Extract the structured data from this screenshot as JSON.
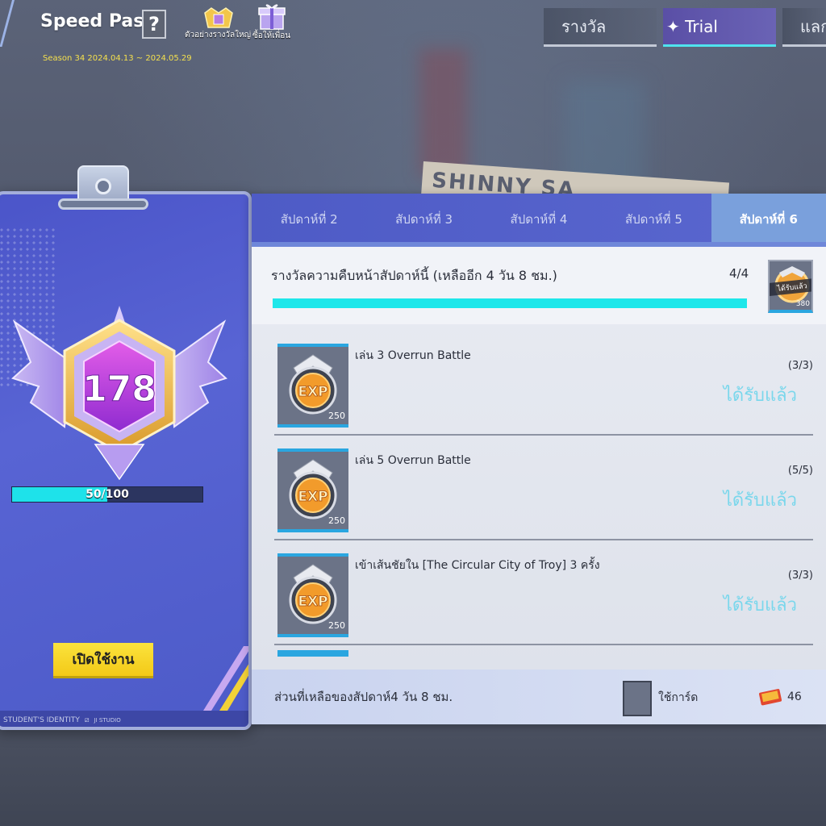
{
  "header": {
    "title": "Speed Pass",
    "help_label": "?",
    "season": "Season 34  2024.04.13 ~ 2024.05.29",
    "icon1_label": "ตัวอย่างรางวัลใหญ่",
    "icon2_label": "ซื้อให้เพื่อน"
  },
  "top_tabs": [
    {
      "label": "รางวัล",
      "active": false
    },
    {
      "label": "✦ Trial",
      "active": true
    },
    {
      "label": "แลก",
      "active": false
    }
  ],
  "background": {
    "sign_text": "SHINNY SA"
  },
  "id_card": {
    "level": "178",
    "xp_current": 50,
    "xp_max": 100,
    "xp_text": "50/100",
    "activate_button": "เปิดใช้งาน",
    "footer_text": "STUDENT'S IDENTITY",
    "footer_small": "JI STUDIO"
  },
  "week_tabs": [
    {
      "label": "สัปดาห์ที่ 2",
      "active": false
    },
    {
      "label": "สัปดาห์ที่ 3",
      "active": false
    },
    {
      "label": "สัปดาห์ที่ 4",
      "active": false
    },
    {
      "label": "สัปดาห์ที่ 5",
      "active": false
    },
    {
      "label": "สัปดาห์ที่ 6",
      "active": true
    }
  ],
  "progress": {
    "title": "รางวัลความคืบหน้าสัปดาห์นี้ (เหลืออีก 4 วัน 8 ชม.)",
    "count": "4/4",
    "fraction": 1.0,
    "reward_claimed": "ได้รับแล้ว",
    "reward_amount": "380"
  },
  "quests": [
    {
      "name": "เล่น 3 Overrun Battle",
      "progress": "(3/3)",
      "status": "ได้รับแล้ว",
      "exp": "250"
    },
    {
      "name": "เล่น 5 Overrun Battle",
      "progress": "(5/5)",
      "status": "ได้รับแล้ว",
      "exp": "250"
    },
    {
      "name": "เข้าเส้นชัยใน [The Circular City of Troy] 3 ครั้ง",
      "progress": "(3/3)",
      "status": "ได้รับแล้ว",
      "exp": "250"
    }
  ],
  "footer": {
    "remaining": "ส่วนที่เหลือของสัปดาห์4 วัน 8 ชม.",
    "use_card": "ใช้การ์ด",
    "ticket_count": "46"
  },
  "colors": {
    "accent_cyan": "#1ee7ea",
    "claimed_text": "#7ad7ec",
    "button_yellow": "#fbe33d",
    "card_blue": "#4b55c9"
  }
}
